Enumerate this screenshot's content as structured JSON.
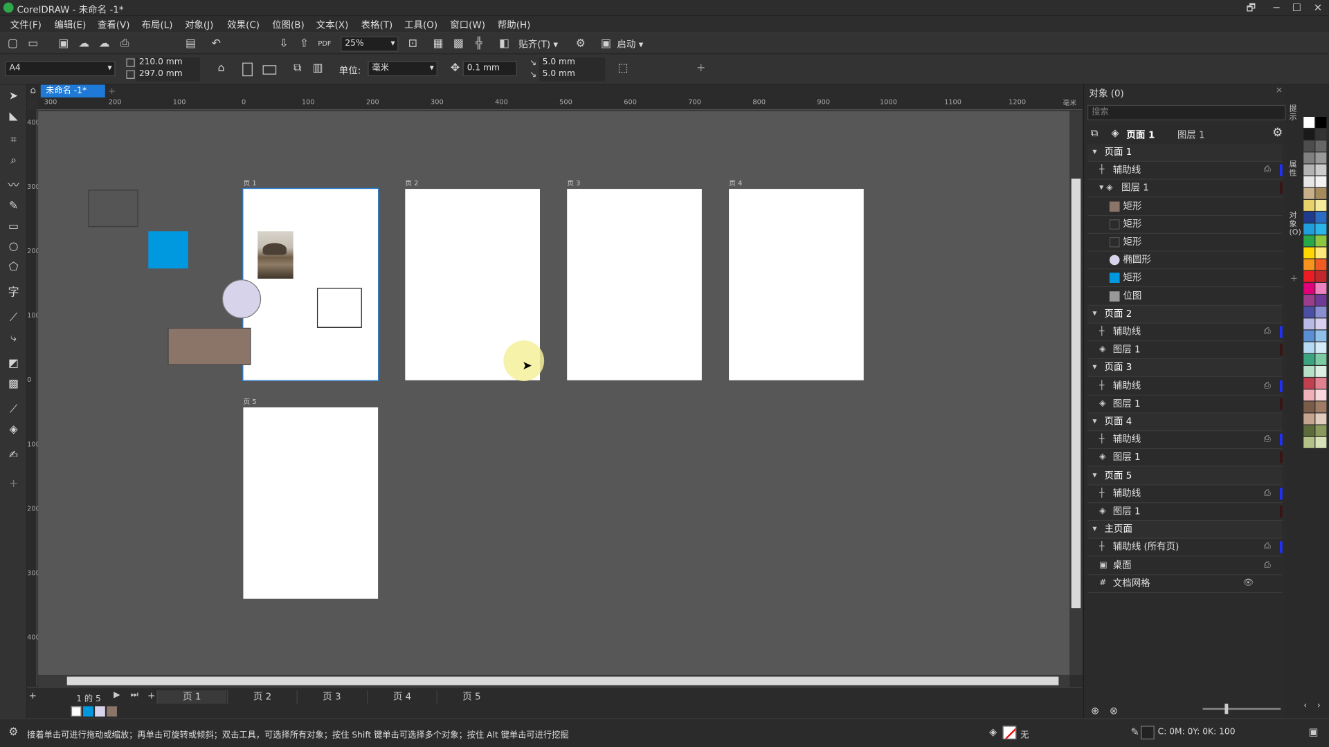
{
  "window": {
    "title": "CorelDRAW - 未命名 -1*",
    "controls": [
      "🗗",
      "─",
      "☐",
      "✕"
    ]
  },
  "menu": [
    "文件(F)",
    "编辑(E)",
    "查看(V)",
    "布局(L)",
    "对象(J)",
    "效果(C)",
    "位图(B)",
    "文本(X)",
    "表格(T)",
    "工具(O)",
    "窗口(W)",
    "帮助(H)"
  ],
  "toolbar": {
    "zoom": "25%",
    "snap": "贴齐(T)",
    "launch": "启动"
  },
  "props": {
    "paper": "A4",
    "width": "210.0 mm",
    "height": "297.0 mm",
    "unit_label": "单位:",
    "unit": "毫米",
    "nudge": "0.1 mm",
    "dup_x": "5.0 mm",
    "dup_y": "5.0 mm"
  },
  "doc_tab": "未命名 -1*",
  "ruler": {
    "h_ticks": [
      "300",
      "200",
      "100",
      "0",
      "100",
      "200",
      "300",
      "400",
      "500",
      "600",
      "700",
      "800",
      "900",
      "1000",
      "1100",
      "1200"
    ],
    "unit": "毫米",
    "v_ticks": [
      "400",
      "300",
      "200",
      "100",
      "0",
      "100",
      "200",
      "300",
      "400"
    ]
  },
  "pages": [
    {
      "label": "页 1"
    },
    {
      "label": "页 2"
    },
    {
      "label": "页 3"
    },
    {
      "label": "页 4"
    },
    {
      "label": "页 5"
    }
  ],
  "page_nav": {
    "current": "1",
    "of": "的",
    "total": "5"
  },
  "page_tabs": [
    "页 1",
    "页 2",
    "页 3",
    "页 4",
    "页 5"
  ],
  "status": {
    "hint": "接着单击可进行拖动或缩放；再单击可旋转或倾斜；双击工具，可选择所有对象；按住 Shift 键单击可选择多个对象；按住 Alt 键单击可进行挖掘",
    "fill_none": "无",
    "cmyk": "C: 0M: 0Y: 0K: 100"
  },
  "objects_panel": {
    "title": "对象 (0)",
    "search_placeholder": "搜索",
    "current_page": "页面 1",
    "current_layer": "图层 1",
    "rows": [
      {
        "label": "页面 1",
        "indent": 0,
        "type": "page"
      },
      {
        "label": "辅助线",
        "indent": 1,
        "type": "guides"
      },
      {
        "label": "图层 1",
        "indent": 1,
        "type": "layer"
      },
      {
        "label": "矩形",
        "indent": 2,
        "type": "rect",
        "swatch": "#8b7468"
      },
      {
        "label": "矩形",
        "indent": 2,
        "type": "rect",
        "swatch": "none"
      },
      {
        "label": "矩形",
        "indent": 2,
        "type": "rect",
        "swatch": "none"
      },
      {
        "label": "椭圆形",
        "indent": 2,
        "type": "ellipse",
        "swatch": "#d7d3ea"
      },
      {
        "label": "矩形",
        "indent": 2,
        "type": "rect",
        "swatch": "#0099e0"
      },
      {
        "label": "位图",
        "indent": 2,
        "type": "bitmap",
        "swatch": "#999"
      },
      {
        "label": "页面 2",
        "indent": 0,
        "type": "page"
      },
      {
        "label": "辅助线",
        "indent": 1,
        "type": "guides"
      },
      {
        "label": "图层 1",
        "indent": 1,
        "type": "layer"
      },
      {
        "label": "页面 3",
        "indent": 0,
        "type": "page"
      },
      {
        "label": "辅助线",
        "indent": 1,
        "type": "guides"
      },
      {
        "label": "图层 1",
        "indent": 1,
        "type": "layer"
      },
      {
        "label": "页面 4",
        "indent": 0,
        "type": "page"
      },
      {
        "label": "辅助线",
        "indent": 1,
        "type": "guides"
      },
      {
        "label": "图层 1",
        "indent": 1,
        "type": "layer"
      },
      {
        "label": "页面 5",
        "indent": 0,
        "type": "page"
      },
      {
        "label": "辅助线",
        "indent": 1,
        "type": "guides"
      },
      {
        "label": "图层 1",
        "indent": 1,
        "type": "layer"
      },
      {
        "label": "主页面",
        "indent": 0,
        "type": "page"
      },
      {
        "label": "辅助线 (所有页)",
        "indent": 1,
        "type": "guides"
      },
      {
        "label": "桌面",
        "indent": 1,
        "type": "desktop"
      },
      {
        "label": "文档网格",
        "indent": 1,
        "type": "grid"
      }
    ]
  },
  "side_tabs": [
    "提示",
    "属性",
    "对象 (O)"
  ],
  "colors": {
    "accent": "#1e90ff",
    "rect_blue": "#0099e0",
    "rect_brown": "#8b7468",
    "rect_gray": "#555555",
    "ellipse": "#d7d3ea",
    "cursor_halo": "#f4f09a"
  },
  "palette": [
    "#ffffff",
    "#000000",
    "#1a1a1a",
    "#333333",
    "#4d4d4d",
    "#666666",
    "#808080",
    "#999999",
    "#b3b3b3",
    "#cccccc",
    "#e6e6e6",
    "#f2f2f2",
    "#c8b08a",
    "#a58a5c",
    "#e8d26a",
    "#f4ea9c",
    "#203a8c",
    "#2b6cc4",
    "#1f9fde",
    "#2cb5e8",
    "#27a94a",
    "#8dc63f",
    "#fdd700",
    "#ffe97a",
    "#f7941d",
    "#f15a24",
    "#ed1c24",
    "#c1272d",
    "#e2007a",
    "#ee82c0",
    "#9b3f8c",
    "#6d3b96",
    "#4a4fa3",
    "#8a8fd0",
    "#b9b9e8",
    "#d9d0ef",
    "#5a8fd3",
    "#90c0ea",
    "#b4dbf3",
    "#d5ecf8",
    "#3aa37f",
    "#7ccba4",
    "#b6e0c8",
    "#dbf0e2",
    "#c04050",
    "#e08090",
    "#f0b0b8",
    "#f8d8dc",
    "#7a5c48",
    "#a07c66",
    "#c4a48e",
    "#e2ccbe",
    "#5c6b3a",
    "#8a9a5c",
    "#b4c288",
    "#d8e2b8"
  ]
}
